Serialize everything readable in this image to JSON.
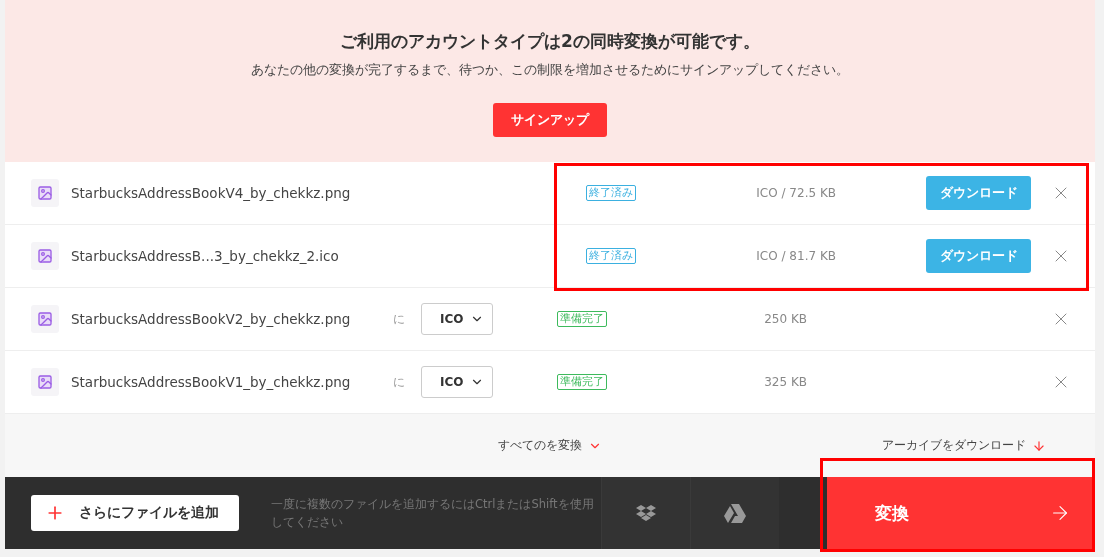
{
  "notice": {
    "title": "ご利用のアカウントタイプは2の同時変換が可能です。",
    "message": "あなたの他の変換が完了するまで、待つか、この制限を増加させるためにサインアップしてください。",
    "button": "サインアップ"
  },
  "files": [
    {
      "kind": "done",
      "name": "StarbucksAddressBookV4_by_chekkz.png",
      "status": "終了済み",
      "size": "ICO / 72.5 KB",
      "action": "ダウンロード",
      "highlighted": true
    },
    {
      "kind": "done",
      "name": "StarbucksAddressB...3_by_chekkz_2.ico",
      "status": "終了済み",
      "size": "ICO / 81.7 KB",
      "action": "ダウンロード",
      "highlighted": true
    },
    {
      "kind": "ready",
      "name": "StarbucksAddressBookV2_by_chekkz.png",
      "to": "に",
      "format": "ICO",
      "status": "準備完了",
      "size": "250 KB"
    },
    {
      "kind": "ready",
      "name": "StarbucksAddressBookV1_by_chekkz.png",
      "to": "に",
      "format": "ICO",
      "status": "準備完了",
      "size": "325 KB"
    }
  ],
  "convert_all": "すべてのを変換",
  "download_archive": "アーカイブをダウンロード",
  "bottom_bar": {
    "add_button": "さらにファイルを追加",
    "hint": "一度に複数のファイルを追加するにはCtrlまたはShiftを使用してください",
    "convert_button": "変換",
    "convert_highlighted": true
  }
}
